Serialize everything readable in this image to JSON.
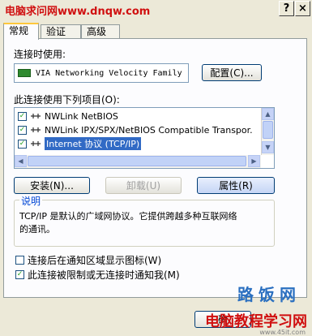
{
  "titlebar": {
    "watermark": "电脑求问网www.dnqw.com",
    "help_label": "?",
    "close_label": "×"
  },
  "tabs": [
    {
      "label": "常规"
    },
    {
      "label": "验证"
    },
    {
      "label": "高级"
    }
  ],
  "connect_using": {
    "label": "连接时使用:",
    "adapter": "VIA Networking Velocity Family",
    "config_button": "配置(C)..."
  },
  "components": {
    "label": "此连接使用下列项目(O):",
    "items": [
      {
        "label": "NWLink NetBIOS",
        "checked": true
      },
      {
        "label": "NWLink IPX/SPX/NetBIOS Compatible Transpor.",
        "checked": true
      },
      {
        "label": "Internet 协议 (TCP/IP)",
        "checked": true,
        "selected": true
      }
    ],
    "check_mark": "✓",
    "install_button": "安装(N)...",
    "uninstall_button": "卸载(U)",
    "properties_button": "属性(R)"
  },
  "description": {
    "title": "说明",
    "text_line1": "TCP/IP 是默认的广域网协议。它提供跨越多种互联网络",
    "text_line2": "的通讯。"
  },
  "options": [
    {
      "label": "连接后在通知区域显示图标(W)",
      "checked": false
    },
    {
      "label": "此连接被限制或无连接时通知我(M)",
      "checked": true
    }
  ],
  "footer": {
    "ok_button": "确",
    "watermark_main": "电脑教程学习网",
    "watermark_secondary": "路饭网",
    "watermark_url": "www.45it.com"
  }
}
